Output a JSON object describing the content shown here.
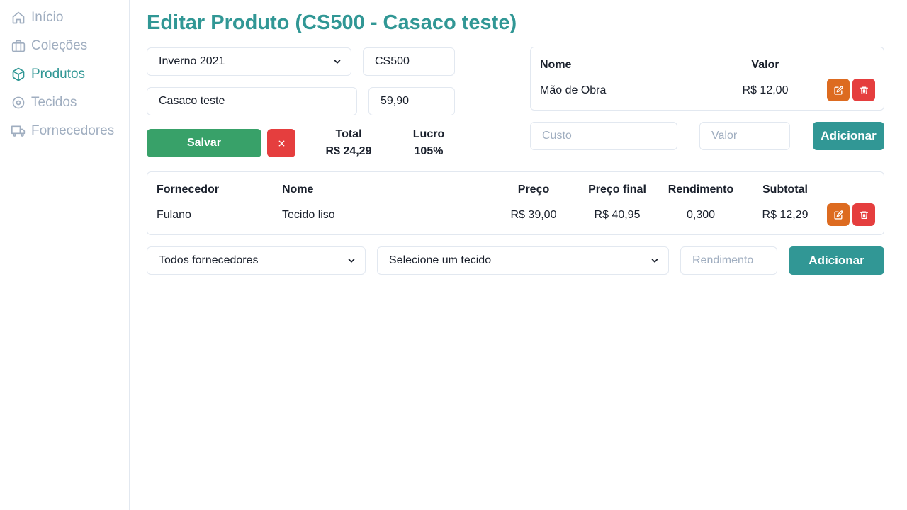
{
  "sidebar": {
    "items": [
      {
        "label": "Início",
        "icon": "home-icon",
        "active": false
      },
      {
        "label": "Coleções",
        "icon": "briefcase-icon",
        "active": false
      },
      {
        "label": "Produtos",
        "icon": "box-icon",
        "active": true
      },
      {
        "label": "Tecidos",
        "icon": "target-icon",
        "active": false
      },
      {
        "label": "Fornecedores",
        "icon": "truck-icon",
        "active": false
      }
    ]
  },
  "page": {
    "title": "Editar Produto (CS500 - Casaco teste)"
  },
  "form": {
    "collection": "Inverno 2021",
    "code": "CS500",
    "name": "Casaco teste",
    "price": "59,90",
    "save_label": "Salvar",
    "cancel_icon": "close-icon"
  },
  "summary": {
    "total_label": "Total",
    "total_value": "R$ 24,29",
    "profit_label": "Lucro",
    "profit_value": "105%"
  },
  "costs": {
    "headers": {
      "name": "Nome",
      "value": "Valor"
    },
    "rows": [
      {
        "name": "Mão de Obra",
        "value": "R$ 12,00"
      }
    ],
    "cost_placeholder": "Custo",
    "value_placeholder": "Valor",
    "add_label": "Adicionar"
  },
  "fabrics": {
    "headers": {
      "supplier": "Fornecedor",
      "name": "Nome",
      "price": "Preço",
      "final_price": "Preço final",
      "yield": "Rendimento",
      "subtotal": "Subtotal"
    },
    "rows": [
      {
        "supplier": "Fulano",
        "name": "Tecido liso",
        "price": "R$ 39,00",
        "final_price": "R$ 40,95",
        "yield": "0,300",
        "subtotal": "R$ 12,29"
      }
    ],
    "supplier_select": "Todos fornecedores",
    "fabric_select": "Selecione um tecido",
    "yield_placeholder": "Rendimento",
    "add_label": "Adicionar"
  },
  "colors": {
    "accent": "#319795",
    "muted": "#a0aec0",
    "save": "#38a169",
    "danger": "#e53e3e",
    "edit": "#dd6b20"
  }
}
